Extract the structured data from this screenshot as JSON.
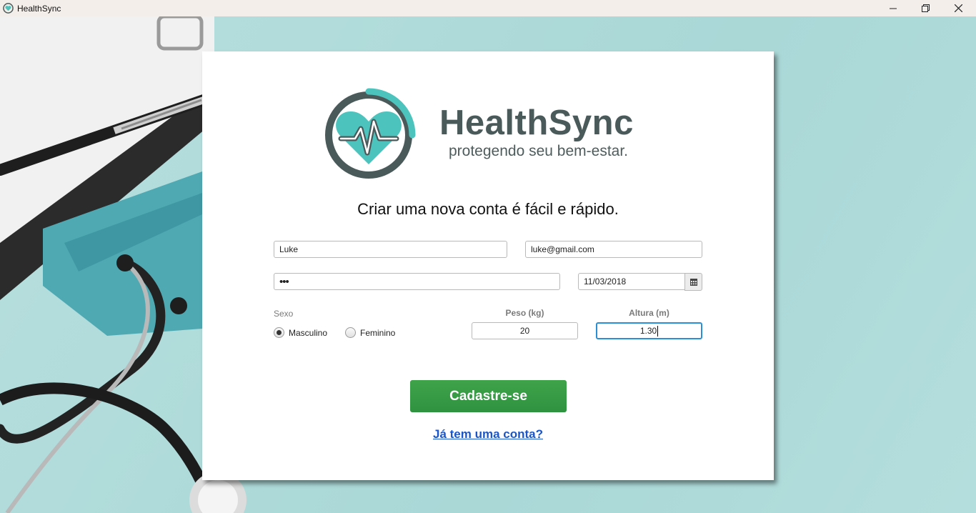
{
  "window": {
    "title": "HealthSync"
  },
  "brand": {
    "name": "HealthSync",
    "tagline": "protegendo seu bem-estar."
  },
  "form": {
    "headline": "Criar uma nova conta é fácil e rápido.",
    "name_value": "Luke",
    "email_value": "luke@gmail.com",
    "password_value": "•••",
    "birthdate_value": "11/03/2018",
    "sex_label": "Sexo",
    "sex_options": [
      "Masculino",
      "Feminino"
    ],
    "sex_selected": "Masculino",
    "weight_label": "Peso (kg)",
    "weight_value": "20",
    "height_label": "Altura (m)",
    "height_value": "1.30",
    "submit_label": "Cadastre-se",
    "login_link": "Já tem uma conta?"
  },
  "colors": {
    "accent_green": "#3a9c45",
    "link_blue": "#1a55c9",
    "logo_teal": "#4cc3bd",
    "logo_gray": "#4a5a5a"
  },
  "icons": [
    "app-heart-icon",
    "minimize-icon",
    "maximize-icon",
    "close-icon",
    "calendar-icon"
  ]
}
